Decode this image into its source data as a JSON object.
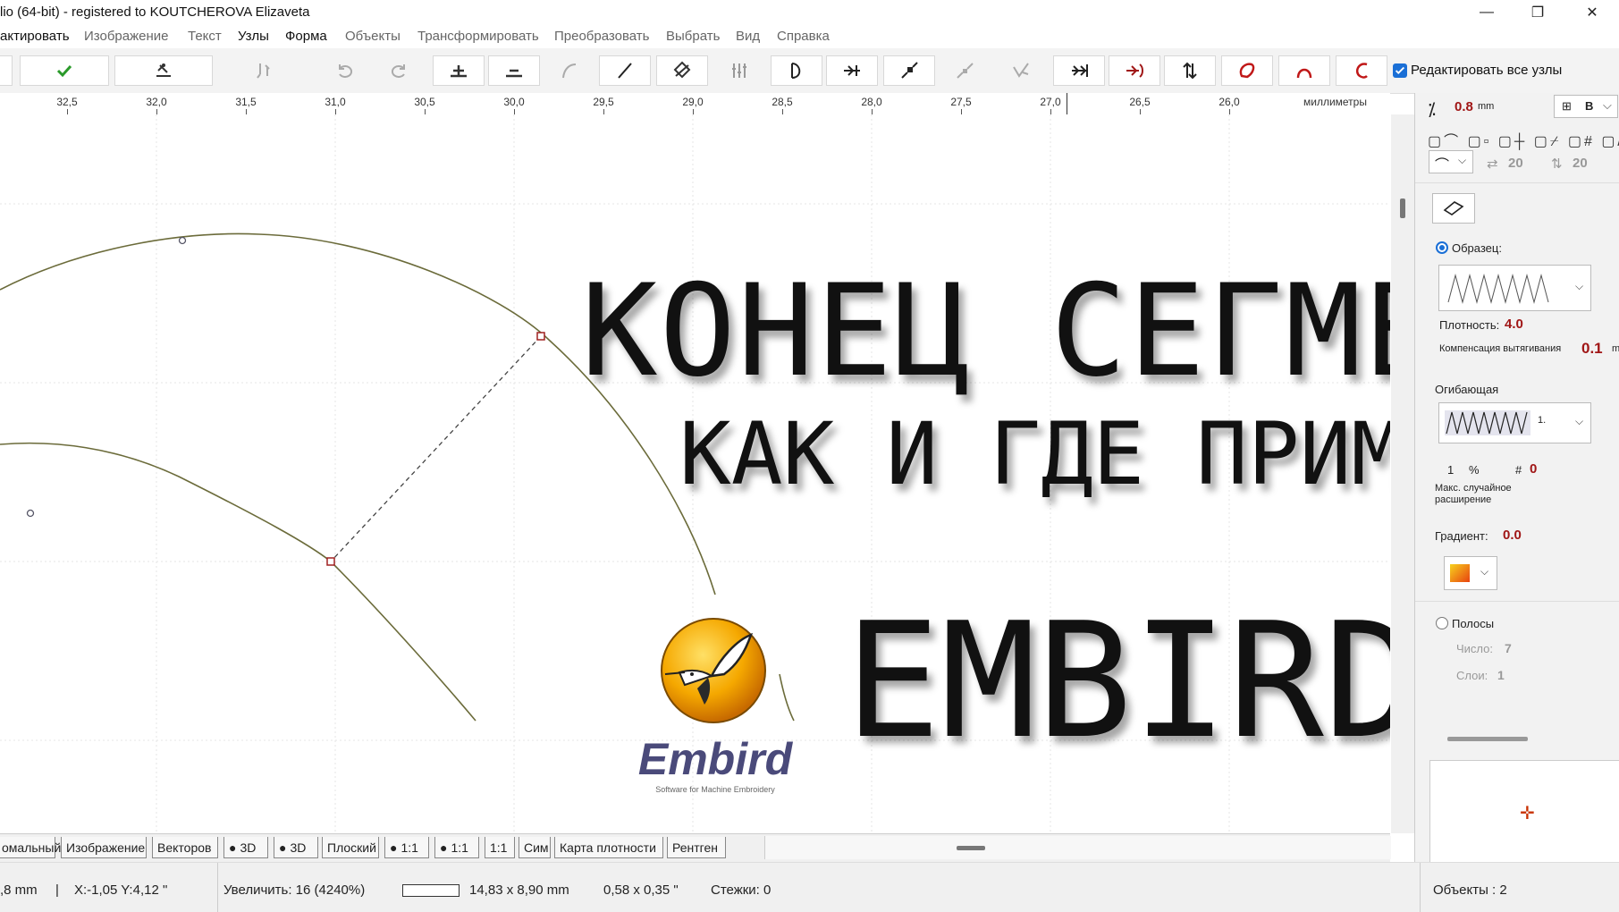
{
  "window": {
    "title": "lio (64-bit)  - registered to KOUTCHEROVA Elizaveta",
    "minimize_glyph": "—",
    "maximize_glyph": "❐",
    "close_glyph": "✕"
  },
  "menu": [
    "актировать",
    "Изображение",
    "Текст",
    "Узлы",
    "Форма",
    "Объекты",
    "Трансформировать",
    "Преобразовать",
    "Выбрать",
    "Вид",
    "Справка"
  ],
  "toolbar": {
    "edit_all_nodes_label": "Редактировать все узлы",
    "edit_all_nodes_checked": true
  },
  "ruler": {
    "labels": [
      "32,5",
      "32,0",
      "31,5",
      "31,0",
      "30,5",
      "30,0",
      "29,5",
      "29,0",
      "28,5",
      "28,0",
      "27,5",
      "27,0",
      "26,5",
      "26,0"
    ],
    "unit": "миллиметры"
  },
  "overlay": {
    "line1": "КОНЕЦ СЕГМЕНТА",
    "line2": "КАК И ГДЕ ПРИМЕНЯТЬ",
    "brand": "EMBIRD",
    "logo_text": "Embird",
    "logo_tagline": "Software for Machine Embroidery"
  },
  "panel": {
    "width_value": "0.8",
    "width_unit": "mm",
    "preset_letter": "B",
    "step1": "20",
    "step2": "20",
    "sample_label": "Образец:",
    "density_label": "Плотность:",
    "density_value": "4.0",
    "compensation_label": "Компенсация вытягивания",
    "compensation_value": "0.1",
    "compensation_unit": "m",
    "envelope_label": "Огибающая",
    "envelope_value": "1.",
    "percent_value": "1",
    "percent_sign": "%",
    "hash_value": "0",
    "max_random_label": "Макс. случайное расширение",
    "gradient_label": "Градиент:",
    "gradient_value": "0.0",
    "stripes_label": "Полосы",
    "count_label": "Число:",
    "count_value": "7",
    "layers_label": "Слои:",
    "layers_value": "1"
  },
  "tabs": [
    "омальный",
    "Изображение",
    "Векторов",
    "3D",
    "3D",
    "Плоский",
    "1:1",
    "1:1",
    "1:1",
    "Сим",
    "Карта плотности",
    "Рентген"
  ],
  "status": {
    "size": ",8 mm",
    "sep": "|",
    "coords": "X:-1,05  Y:4,12 \"",
    "zoom": "Увеличить:  16 (4240%)",
    "dims": "14,83 x 8,90 mm",
    "dims_in": "0,58 x 0,35 \"",
    "stitches": "Стежки:  0",
    "objects": "Объекты : 2"
  },
  "colors": {
    "curve": "#6b6b3a",
    "node_red": "#a02020",
    "value_red": "#a01616",
    "accent_blue": "#1a6fd6"
  }
}
